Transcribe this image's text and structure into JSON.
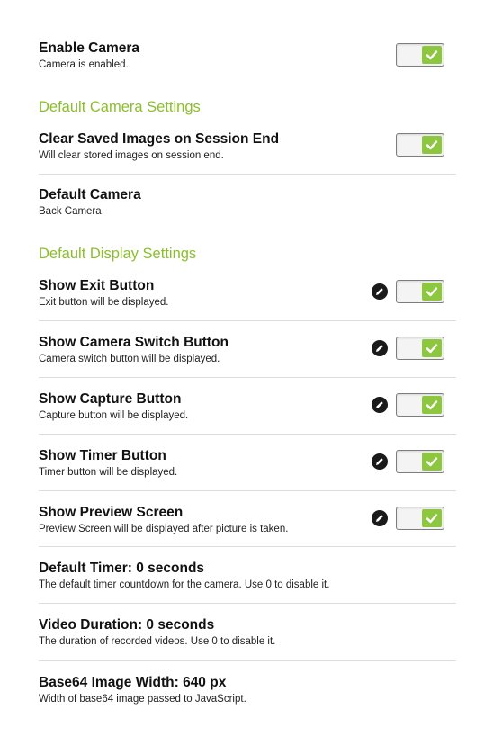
{
  "accent_color": "#8dc63f",
  "section_color": "#8bbf2a",
  "icons": {
    "toggle_check": "check-icon",
    "edit": "pencil-icon"
  },
  "enable_camera": {
    "title": "Enable Camera",
    "summary": "Camera is enabled.",
    "checked": true
  },
  "sections": {
    "camera": "Default Camera Settings",
    "display": "Default Display Settings"
  },
  "clear_saved": {
    "title": "Clear Saved Images on Session End",
    "summary": "Will clear stored images on session end.",
    "checked": true
  },
  "default_camera": {
    "title": "Default Camera",
    "summary": "Back Camera"
  },
  "show_exit": {
    "title": "Show Exit Button",
    "summary": "Exit button will be displayed.",
    "checked": true
  },
  "show_switch": {
    "title": "Show Camera Switch Button",
    "summary": "Camera switch button will be displayed.",
    "checked": true
  },
  "show_capture": {
    "title": "Show Capture Button",
    "summary": "Capture button will be displayed.",
    "checked": true
  },
  "show_timer": {
    "title": "Show Timer Button",
    "summary": "Timer button will be displayed.",
    "checked": true
  },
  "show_preview": {
    "title": "Show Preview Screen",
    "summary": "Preview Screen will be displayed after picture is taken.",
    "checked": true
  },
  "default_timer": {
    "title": "Default Timer: 0 seconds",
    "summary": "The default timer countdown for the camera. Use 0 to disable it."
  },
  "video_duration": {
    "title": "Video Duration: 0 seconds",
    "summary": "The duration of recorded videos. Use 0 to disable it."
  },
  "base64_width": {
    "title": "Base64 Image Width: 640 px",
    "summary": "Width of base64 image passed to JavaScript."
  }
}
